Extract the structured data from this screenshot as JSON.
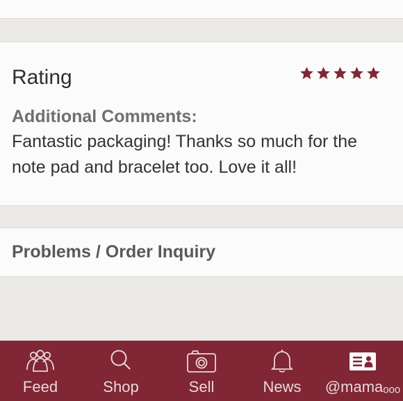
{
  "rating": {
    "title": "Rating",
    "stars": 5,
    "star_color": "#802634"
  },
  "comments": {
    "label": "Additional Comments:",
    "text": "Fantastic packaging! Thanks so much for the note pad and bracelet too. Love it all!"
  },
  "problems": {
    "title": "Problems / Order Inquiry"
  },
  "nav": {
    "background": "#802634",
    "items": [
      {
        "label": "Feed",
        "icon": "people-icon"
      },
      {
        "label": "Shop",
        "icon": "search-icon"
      },
      {
        "label": "Sell",
        "icon": "camera-icon"
      },
      {
        "label": "News",
        "icon": "bell-icon"
      },
      {
        "label": "@mamaₒₒₒ",
        "icon": "profile-card-icon"
      }
    ]
  }
}
